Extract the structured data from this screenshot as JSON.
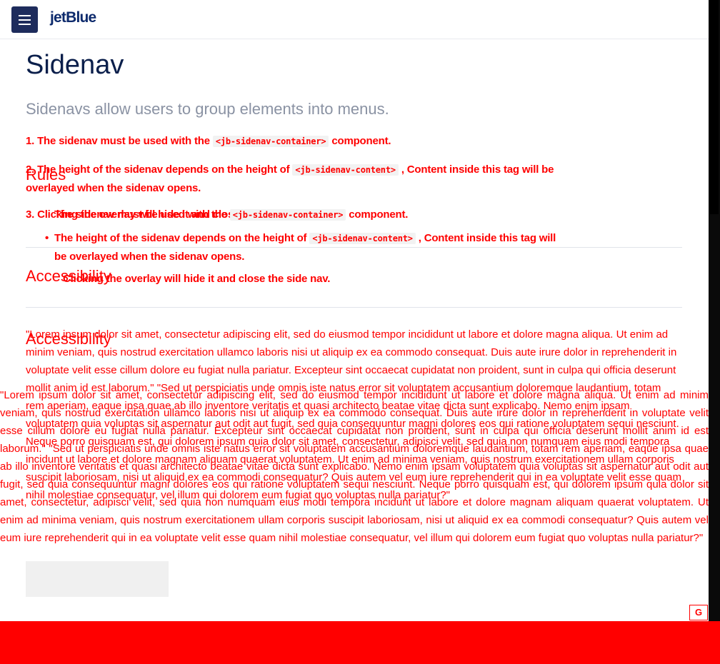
{
  "header": {
    "logo": "jetBlue"
  },
  "page": {
    "title": "Sidenav",
    "subtitle": "Sidenavs allow users to group elements into menus."
  },
  "sections": {
    "rules": "Rules",
    "accessibility_1": "Accessibility",
    "accessibility_2": "Accessibility"
  },
  "rules_list": {
    "item1_pre": "1. The sidenav must be used with the",
    "item1_code": "<jb-sidenav-container>",
    "item1_post": "component.",
    "item2_pre": "2. The height of the sidenav depends on the height of",
    "item2_code": "<jb-sidenav-content>",
    "item2_post": ", Content inside this tag will be",
    "item2_post2": "overlayed when the sidenav opens.",
    "item3_text": "3. Clicking the overlay will hide it and close the side nav.",
    "item3b_pre": "The sidenav must be used with the",
    "item3b_code": "<jb-sidenav-container>",
    "item3b_post": "component."
  },
  "bullet_list": {
    "b1_pre": "The height of the sidenav depends on the height of",
    "b1_code": "<jb-sidenav-content>",
    "b1_post": ", Content inside this tag will",
    "b1_post2": "be overlayed when the sidenav opens.",
    "b2_text": "Clicking the overlay will hide it and close the side nav."
  },
  "lorem": {
    "para1": "\"Lorem ipsum dolor sit amet, consectetur adipiscing elit, sed do eiusmod tempor incididunt ut labore et dolore magna aliqua. Ut enim ad minim veniam, quis nostrud exercitation ullamco laboris nisi ut aliquip ex ea commodo consequat. Duis aute irure dolor in reprehenderit in voluptate velit esse cillum dolore eu fugiat nulla pariatur. Excepteur sint occaecat cupidatat non proident, sunt in culpa qui officia deserunt mollit anim id est laborum.\" \"Sed ut perspiciatis unde omnis iste natus error sit voluptatem accusantium doloremque laudantium, totam rem aperiam, eaque ipsa quae ab illo inventore veritatis et quasi architecto beatae vitae dicta sunt explicabo. Nemo enim ipsam voluptatem quia voluptas sit aspernatur aut odit aut fugit, sed quia consequuntur magni dolores eos qui ratione voluptatem sequi nesciunt. Neque porro quisquam est, qui dolorem ipsum quia dolor sit amet, consectetur, adipisci velit, sed quia non numquam eius modi tempora incidunt ut labore et dolore magnam aliquam quaerat voluptatem. Ut enim ad minima veniam, quis nostrum exercitationem ullam corporis suscipit laboriosam, nisi ut aliquid ex ea commodi consequatur? Quis autem vel eum iure reprehenderit qui in ea voluptate velit esse quam nihil molestiae consequatur, vel illum qui dolorem eum fugiat quo voluptas nulla pariatur?\"",
    "para2": "\"Lorem ipsum dolor sit amet, consectetur adipiscing elit, sed do eiusmod tempor incididunt ut labore et dolore magna aliqua. Ut enim ad minim veniam, quis nostrud exercitation ullamco laboris nisi ut aliquip ex ea commodo consequat. Duis aute irure dolor in reprehenderit in voluptate velit esse cillum dolore eu fugiat nulla pariatur. Excepteur sint occaecat cupidatat non proident, sunt in culpa qui officia deserunt mollit anim id est laborum.\" \"Sed ut perspiciatis unde omnis iste natus error sit voluptatem accusantium doloremque laudantium, totam rem aperiam, eaque ipsa quae ab illo inventore veritatis et quasi architecto beatae vitae dicta sunt explicabo. Nemo enim ipsam voluptatem quia voluptas sit aspernatur aut odit aut fugit, sed quia consequuntur magni dolores eos qui ratione voluptatem sequi nesciunt. Neque porro quisquam est, qui dolorem ipsum quia dolor sit amet, consectetur, adipisci velit, sed quia non numquam eius modi tempora incidunt ut labore et dolore magnam aliquam quaerat voluptatem. Ut enim ad minima veniam, quis nostrum exercitationem ullam corporis suscipit laboriosam, nisi ut aliquid ex ea commodi consequatur? Quis autem vel eum iure reprehenderit qui in ea voluptate velit esse quam nihil molestiae consequatur, vel illum qui dolorem eum fugiat quo voluptas nulla pariatur?\""
  },
  "badge": {
    "label": "G"
  },
  "colors": {
    "overlay_text": "#ff0000",
    "brand_navy": "#1e2c5c",
    "footer": "#ff0000"
  },
  "icons": {
    "menu": "hamburger-menu-icon"
  }
}
